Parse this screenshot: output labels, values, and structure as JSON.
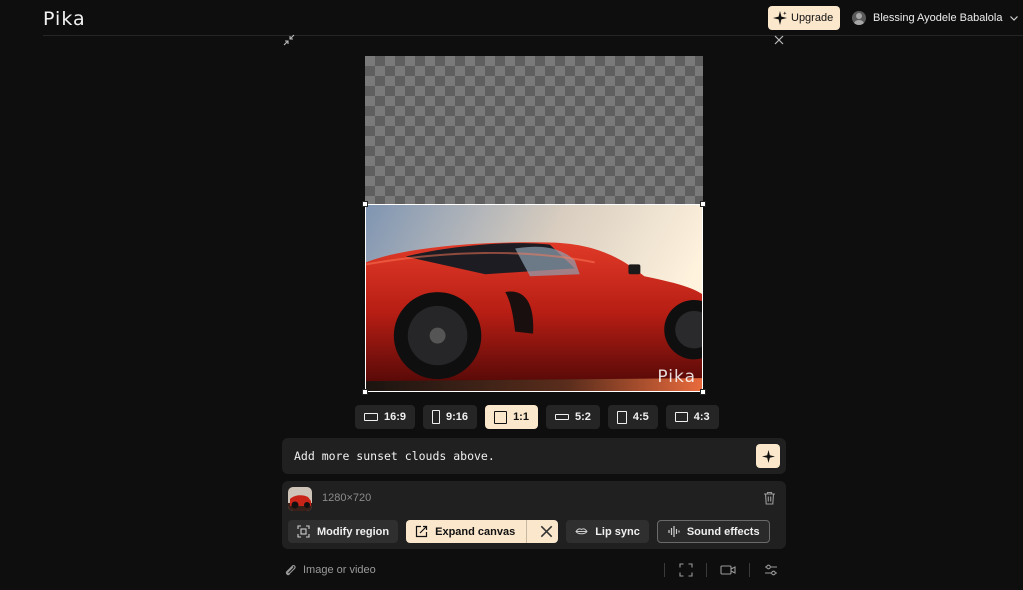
{
  "app": {
    "logo": "Pika"
  },
  "header": {
    "upgrade_label": "Upgrade",
    "user_name": "Blessing Ayodele Babalola"
  },
  "canvas": {
    "watermark": "Pika"
  },
  "aspect_ratios": [
    {
      "label": "16:9",
      "selected": false
    },
    {
      "label": "9:16",
      "selected": false
    },
    {
      "label": "1:1",
      "selected": true
    },
    {
      "label": "5:2",
      "selected": false
    },
    {
      "label": "4:5",
      "selected": false
    },
    {
      "label": "4:3",
      "selected": false
    }
  ],
  "prompt": {
    "text": "Add more sunset clouds above."
  },
  "asset": {
    "resolution": "1280×720"
  },
  "tools": {
    "modify_region": "Modify region",
    "expand_canvas": "Expand canvas",
    "lip_sync": "Lip sync",
    "sound_effects": "Sound effects"
  },
  "footer": {
    "attach_label": "Image or video"
  },
  "colors": {
    "accent": "#fbe7cc",
    "background": "#0e0e0e",
    "panel": "#202020"
  },
  "icons": [
    "sparkle-icon",
    "user-avatar-icon",
    "chevron-down-icon",
    "collapse-icon",
    "close-icon",
    "trash-icon",
    "modify-region-icon",
    "expand-canvas-icon",
    "lips-icon",
    "sound-wave-icon",
    "paperclip-icon",
    "fullscreen-icon",
    "video-camera-icon",
    "sliders-icon"
  ]
}
